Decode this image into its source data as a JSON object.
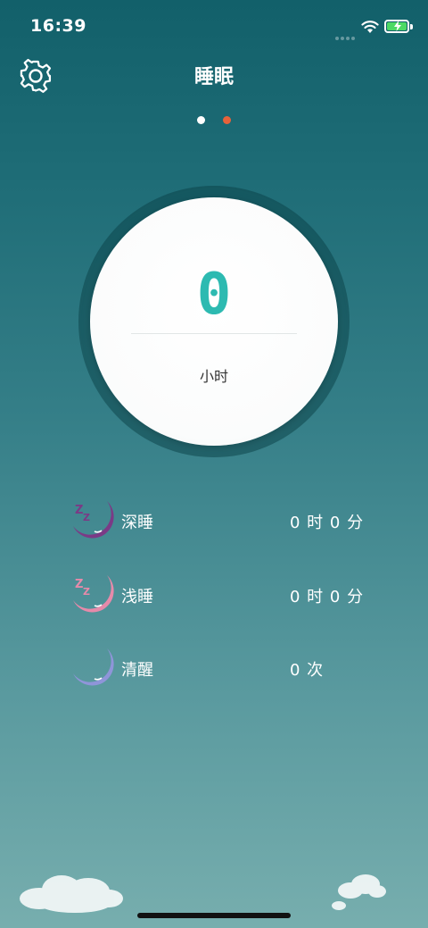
{
  "status_bar": {
    "time": "16:39"
  },
  "header": {
    "title": "睡眠"
  },
  "pager": {
    "count": 2,
    "active_index": 0
  },
  "summary": {
    "hours_value": "0",
    "hours_unit": "小时"
  },
  "stats": [
    {
      "label": "深睡",
      "value": "0 时 0 分",
      "icon": "deep-sleep-moon-icon"
    },
    {
      "label": "浅睡",
      "value": "0 时 0 分",
      "icon": "light-sleep-moon-icon"
    },
    {
      "label": "清醒",
      "value": "0 次",
      "icon": "awake-moon-icon"
    }
  ],
  "colors": {
    "accent": "#2dbab1",
    "pager_inactive": "#e7623a",
    "deep_sleep": "#7b3a86",
    "light_sleep": "#e68aaa",
    "awake": "#8f95d9"
  }
}
